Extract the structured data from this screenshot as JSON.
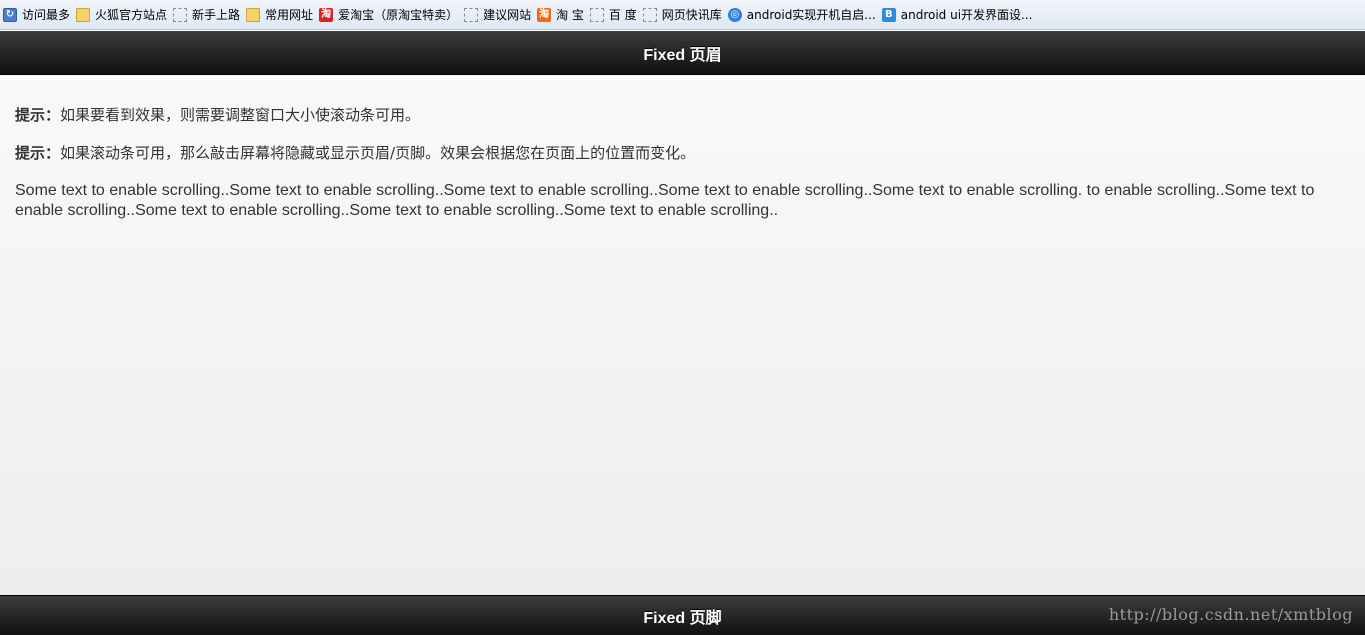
{
  "bookmarks": [
    {
      "label": "访问最多",
      "icon": "history-icon"
    },
    {
      "label": "火狐官方站点",
      "icon": "folder-icon"
    },
    {
      "label": "新手上路",
      "icon": "blank-page-icon"
    },
    {
      "label": "常用网址",
      "icon": "folder-icon"
    },
    {
      "label": "爱淘宝（原淘宝特卖）",
      "icon": "taobao-icon"
    },
    {
      "label": "建议网站",
      "icon": "blank-page-icon"
    },
    {
      "label": "淘 宝",
      "icon": "taobao-icon"
    },
    {
      "label": "百 度",
      "icon": "blank-page-icon"
    },
    {
      "label": "网页快讯库",
      "icon": "blank-page-icon"
    },
    {
      "label": "android实现开机自启...",
      "icon": "globe-icon"
    },
    {
      "label": "android ui开发界面设...",
      "icon": "blog-icon"
    }
  ],
  "header": {
    "title": "Fixed 页眉"
  },
  "content": {
    "tips": [
      {
        "prefix": "提示：",
        "text": "如果要看到效果，则需要调整窗口大小使滚动条可用。"
      },
      {
        "prefix": "提示：",
        "text": "如果滚动条可用，那么敲击屏幕将隐藏或显示页眉/页脚。效果会根据您在页面上的位置而变化。"
      }
    ],
    "scroll_text": "Some text to enable scrolling..Some text to enable scrolling..Some text to enable scrolling..Some text to enable scrolling..Some text to enable scrolling. to enable scrolling..Some text to enable scrolling..Some text to enable scrolling..Some text to enable scrolling..Some text to enable scrolling.."
  },
  "footer": {
    "title": "Fixed 页脚"
  },
  "watermark": "http://blog.csdn.net/xmtblog",
  "colors": {
    "bar_dark": "#111111",
    "bar_light": "#3c3c3c",
    "content_bg": "#f9f9f9",
    "text": "#333333"
  }
}
